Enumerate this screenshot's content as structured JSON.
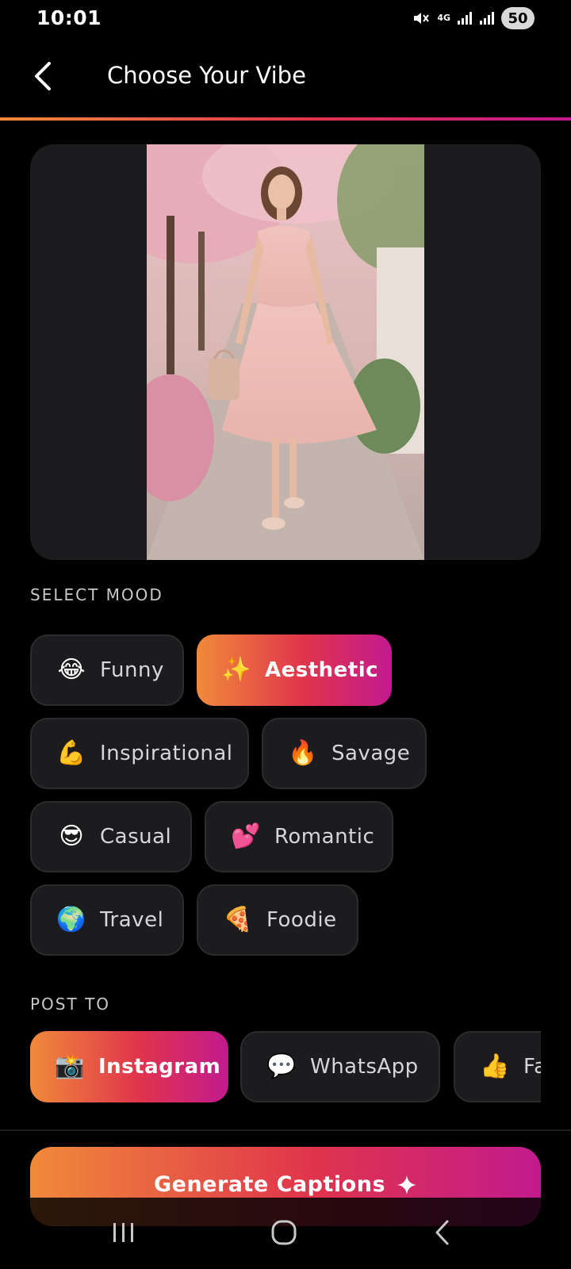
{
  "status_bar": {
    "time": "10:01",
    "network": "4G",
    "battery": "50"
  },
  "header": {
    "title": "Choose Your Vibe"
  },
  "colors": {
    "gradient_start": "#f08a3a",
    "gradient_mid": "#e0344c",
    "gradient_end": "#c21a8e",
    "chip_background": "#1c1c1e"
  },
  "mood_section": {
    "label": "SELECT MOOD",
    "moods": [
      {
        "label": "Funny",
        "emoji": "😂",
        "selected": false
      },
      {
        "label": "Aesthetic",
        "emoji": "✨",
        "selected": true
      },
      {
        "label": "Inspirational",
        "emoji": "💪",
        "selected": false
      },
      {
        "label": "Savage",
        "emoji": "🔥",
        "selected": false
      },
      {
        "label": "Casual",
        "emoji": "😎",
        "selected": false
      },
      {
        "label": "Romantic",
        "emoji": "💕",
        "selected": false
      },
      {
        "label": "Travel",
        "emoji": "🌍",
        "selected": false
      },
      {
        "label": "Foodie",
        "emoji": "🍕",
        "selected": false
      }
    ]
  },
  "post_section": {
    "label": "POST TO",
    "platforms": [
      {
        "label": "Instagram",
        "emoji": "📸",
        "selected": true
      },
      {
        "label": "WhatsApp",
        "emoji": "💬",
        "selected": false
      },
      {
        "label": "Fa",
        "emoji": "👍",
        "selected": false
      }
    ]
  },
  "generate_button": {
    "label": "Generate Captions"
  }
}
